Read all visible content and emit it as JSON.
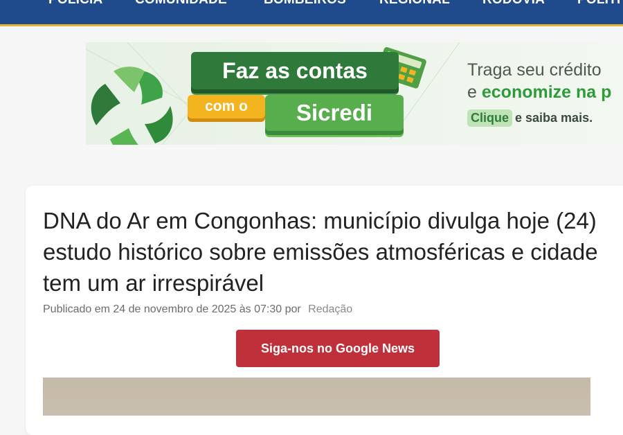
{
  "nav": {
    "items": [
      "POLÍCIA",
      "COMUNIDADE",
      "BOMBEIROS",
      "REGIONAL",
      "RODOVIA",
      "POLÍTI"
    ]
  },
  "banner": {
    "sign1": "Faz as contas",
    "sign2": "com o",
    "sign3": "Sicredi",
    "line1": "Traga seu crédito",
    "line2_prefix": "e",
    "line2_highlight": "economize na p",
    "pill": "Clique",
    "line3_rest": "e saiba mais."
  },
  "article": {
    "title": "DNA do Ar em Congonhas: município divulga hoje (24) estudo histórico sobre emissões atmosféricas e cidade tem um ar irrespirável",
    "published": "Publicado em 24 de novembro de 2025 às 07:30 por",
    "author": "Redação",
    "google_news_button": "Siga-nos no Google News"
  },
  "colors": {
    "nav_bg": "#1f4a8c",
    "nav_accent": "#e6b530",
    "button_red": "#c0303a",
    "sicredi_green": "#2e9b3a"
  }
}
